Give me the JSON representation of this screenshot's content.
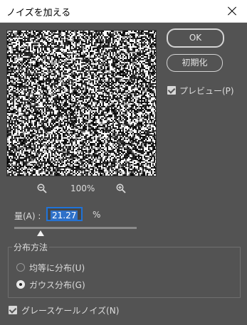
{
  "dialog": {
    "title": "ノイズを加える"
  },
  "preview": {
    "zoom": "100%",
    "zoom_out_icon": "zoom-out-icon",
    "zoom_in_icon": "zoom-in-icon"
  },
  "buttons": {
    "ok": "OK",
    "reset": "初期化"
  },
  "options": {
    "preview_label": "プレビュー(P)",
    "preview_checked": true
  },
  "amount": {
    "label": "量(A) :",
    "value": "21.27",
    "unit": "%",
    "slider_fraction": 0.2127
  },
  "distribution": {
    "title": "分布方法",
    "options": [
      {
        "label": "均等に分布(U)",
        "selected": false
      },
      {
        "label": "ガウス分布(G)",
        "selected": true
      }
    ]
  },
  "monochrome": {
    "label": "グレースケールノイズ(N)",
    "checked": true
  },
  "colors": {
    "background": "#535353",
    "accent": "#1f73d8"
  }
}
